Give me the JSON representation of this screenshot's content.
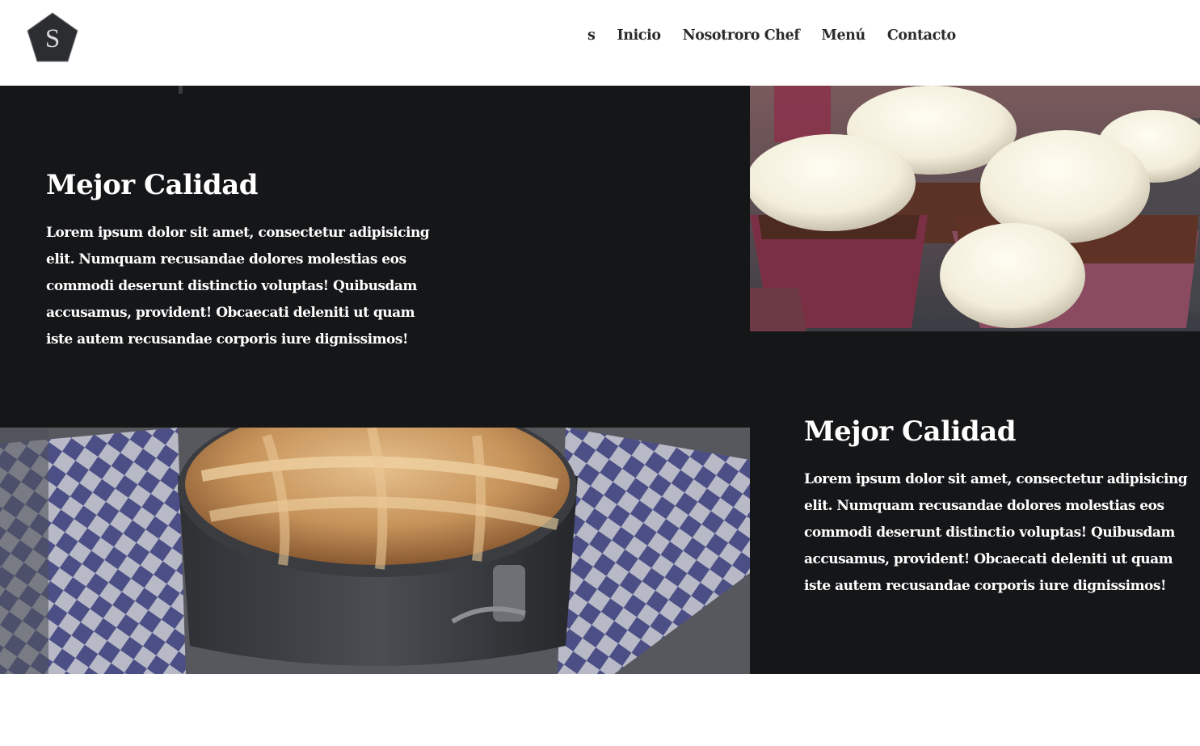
{
  "header": {
    "logo_letter": "S",
    "nav": [
      "s",
      "Inicio",
      "Nosotroro Chef",
      "Menú",
      "Contacto"
    ]
  },
  "sections": [
    {
      "title": "Mejor Calidad",
      "text": "Lorem ipsum dolor sit amet, consectetur adipisicing elit. Numquam recusandae dolores molestias eos commodi deserunt distinctio voluptas! Quibusdam accusamus, provident! Obcaecati deleniti ut quam iste autem recusandae corporis iure dignissimos!",
      "image": "cupcakes-photo"
    },
    {
      "title": "Mejor Calidad",
      "text": "Lorem ipsum dolor sit amet, consectetur adipisicing elit. Numquam recusandae dolores molestias eos commodi deserunt distinctio voluptas! Quibusdam accusamus, provident! Obcaecati deleniti ut quam iste autem recusandae corporis iure dignissimos!",
      "image": "apple-pie-photo"
    }
  ],
  "colors": {
    "dark_section": "#151618",
    "logo": "#2c2d30",
    "nav_text": "#2a2b2d"
  }
}
